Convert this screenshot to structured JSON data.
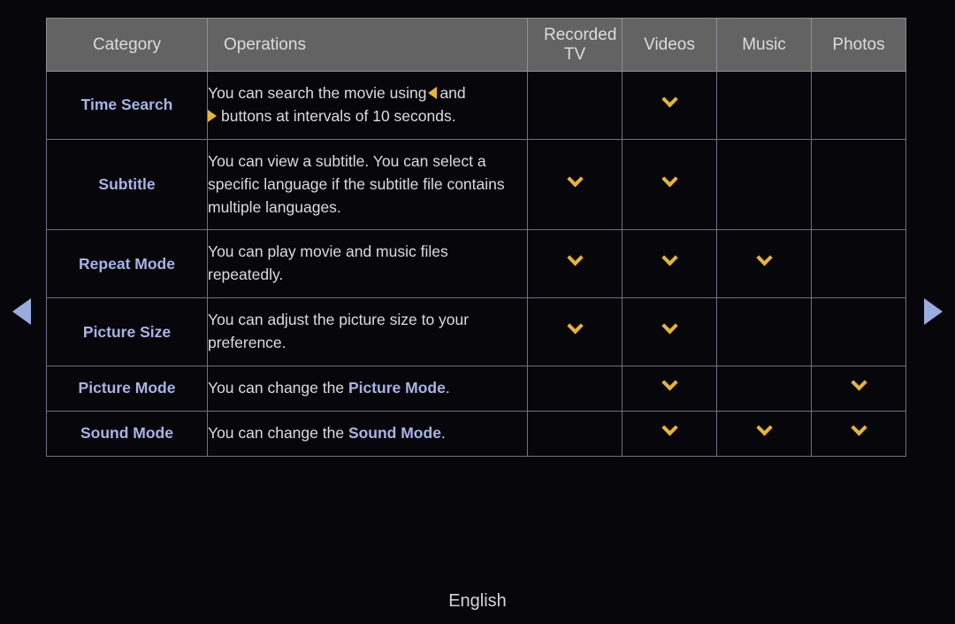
{
  "background_color": "#07060a",
  "accent_colors": {
    "category_text": "#a7b4e6",
    "checkmark": "#e5b43a",
    "nav_arrow": "#9aabe0",
    "header_bg": "#636363"
  },
  "nav": {
    "left_arrow": "left-triangle",
    "right_arrow": "right-triangle"
  },
  "table": {
    "headers": {
      "category": "Category",
      "operations": "Operations",
      "recorded_tv_line1": "Recorded",
      "recorded_tv_line2": "TV",
      "videos": "Videos",
      "music": "Music",
      "photos": "Photos"
    },
    "rows": [
      {
        "category": "Time Search",
        "operation_parts": {
          "a": "You can search the movie using",
          "b": "and",
          "c": "buttons at intervals of 10 seconds."
        },
        "recorded_tv": false,
        "videos": true,
        "music": false,
        "photos": false
      },
      {
        "category": "Subtitle",
        "operation": "You can view a subtitle. You can select a specific language if the subtitle file contains multiple languages.",
        "recorded_tv": true,
        "videos": true,
        "music": false,
        "photos": false
      },
      {
        "category": "Repeat Mode",
        "operation": "You can play movie and music files repeatedly.",
        "recorded_tv": true,
        "videos": true,
        "music": true,
        "photos": false
      },
      {
        "category": "Picture Size",
        "operation": "You can adjust the picture size to your preference.",
        "recorded_tv": true,
        "videos": true,
        "music": false,
        "photos": false
      },
      {
        "category": "Picture Mode",
        "operation_prefix": "You can change the ",
        "operation_highlight": "Picture Mode",
        "operation_suffix": ".",
        "recorded_tv": false,
        "videos": true,
        "music": false,
        "photos": true
      },
      {
        "category": "Sound Mode",
        "operation_prefix": "You can change the ",
        "operation_highlight": "Sound Mode",
        "operation_suffix": ".",
        "recorded_tv": false,
        "videos": true,
        "music": true,
        "photos": true
      }
    ]
  },
  "footer": {
    "language": "English"
  }
}
